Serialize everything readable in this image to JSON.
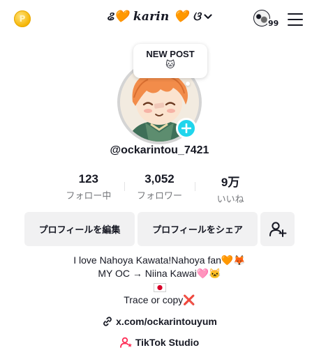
{
  "header": {
    "coin_icon": "coin-icon",
    "coin_glyph": "P",
    "username": "ଌ🧡 karin 🧡 ଓ",
    "dropdown_icon": "chevron-down-icon",
    "notifications_count": "99",
    "menu_icon": "hamburger-menu-icon"
  },
  "profile": {
    "new_post_label": "NEW POST",
    "new_post_emoji": "🐱",
    "handle": "@ockarintou_7421",
    "add_story_icon": "plus-icon",
    "accent_color": "#20d5ec"
  },
  "stats": [
    {
      "value": "123",
      "label": "フォロー中"
    },
    {
      "value": "3,052",
      "label": "フォロワー"
    },
    {
      "value": "9万",
      "label": "いいね"
    }
  ],
  "actions": {
    "edit_profile": "プロフィールを編集",
    "share_profile": "プロフィールをシェア",
    "add_friend_icon": "add-user-icon"
  },
  "bio": {
    "line1": "I love Nahoya Kawata!Nahoya fan🧡🦊",
    "line2": "MY OC → Niina Kawai🩷🐱",
    "line3": "🇯🇵",
    "line4_text": "Trace or copy",
    "line4_mark": "❌"
  },
  "link": {
    "icon": "link-icon",
    "text": "x.com/ockarintouyum"
  },
  "studio": {
    "icon": "tiktok-studio-icon",
    "text": "TikTok Studio",
    "icon_color": "#fe2c55"
  }
}
